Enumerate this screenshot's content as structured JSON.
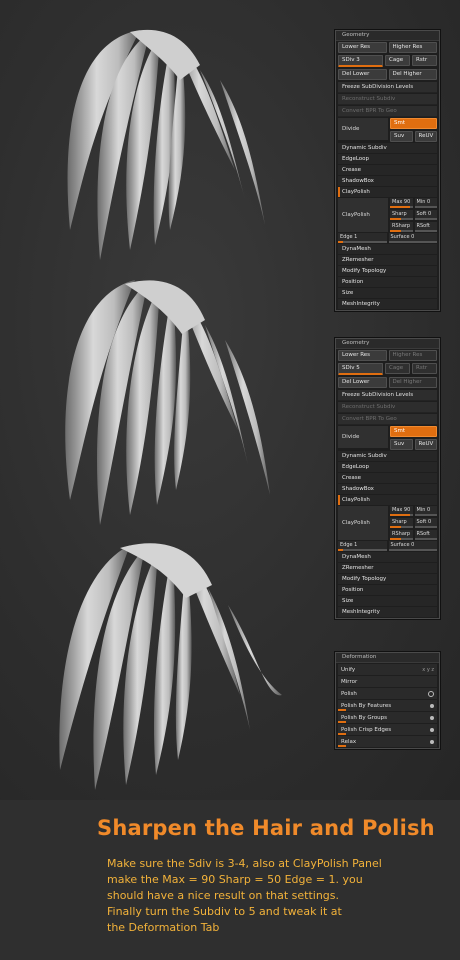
{
  "geometry_panel": {
    "title": "Geometry",
    "lower_res": "Lower Res",
    "higher_res": "Higher Res",
    "sdiv": "SDiv 3",
    "cage": "Cage",
    "rstr": "Rstr",
    "del_lower": "Del Lower",
    "del_higher": "Del Higher",
    "freeze": "Freeze SubDivision Levels",
    "reconstruct": "Reconstruct Subdiv",
    "convert": "Convert BPR To Geo",
    "divide": "Divide",
    "smt": "Smt",
    "suv": "Suv",
    "reuv": "ReUV",
    "dynamic_subdiv": "Dynamic Subdiv",
    "edgeloop": "EdgeLoop",
    "crease": "Crease",
    "shadowbox": "ShadowBox",
    "claypolish_header": "ClayPolish",
    "claypolish_button": "ClayPolish",
    "max": "Max 90",
    "min": "Min 0",
    "sharp": "Sharp",
    "soft": "Soft 0",
    "rsharp": "RSharp",
    "rsoft": "RSoft",
    "edge": "Edge 1",
    "surface": "Surface 0",
    "dynamesh": "DynaMesh",
    "zremesher": "ZRemesher",
    "modify_topology": "Modify Topology",
    "position": "Position",
    "size": "Size",
    "mesh_integrity": "MeshIntegrity"
  },
  "geometry_panel_2": {
    "title": "Geometry",
    "lower_res": "Lower Res",
    "higher_res": "Higher Res",
    "sdiv": "SDiv 5",
    "cage": "Cage",
    "rstr": "Rstr",
    "del_lower": "Del Lower",
    "del_higher": "Del Higher",
    "freeze": "Freeze SubDivision Levels",
    "reconstruct": "Reconstruct Subdiv",
    "convert": "Convert BPR To Geo",
    "divide": "Divide",
    "smt": "Smt",
    "suv": "Suv",
    "reuv": "ReUV",
    "dynamic_subdiv": "Dynamic Subdiv",
    "edgeloop": "EdgeLoop",
    "crease": "Crease",
    "shadowbox": "ShadowBox",
    "claypolish_header": "ClayPolish",
    "claypolish_button": "ClayPolish",
    "max": "Max 90",
    "min": "Min 0",
    "sharp": "Sharp",
    "soft": "Soft 0",
    "rsharp": "RSharp",
    "rsoft": "RSoft",
    "edge": "Edge 1",
    "surface": "Surface 0",
    "dynamesh": "DynaMesh",
    "zremesher": "ZRemesher",
    "modify_topology": "Modify Topology",
    "position": "Position",
    "size": "Size",
    "mesh_integrity": "MeshIntegrity"
  },
  "deformation_panel": {
    "title": "Deformation",
    "unify": "Unify",
    "unify_axes": "x y z",
    "mirror": "Mirror",
    "polish": "Polish",
    "polish_by_features": "Polish By Features",
    "polish_by_groups": "Polish By Groups",
    "polish_crisp_edges": "Polish Crisp Edges",
    "relax": "Relax"
  },
  "slider_levels": {
    "max": 0.9,
    "min": 0.0,
    "sharp": 0.5,
    "soft": 0.0,
    "rsharp": 0.5,
    "rsoft": 0.0,
    "edge": 0.1,
    "surface": 0.0
  },
  "caption": {
    "title": "Sharpen the Hair and Polish",
    "lines": [
      "Make sure the Sdiv is 3-4, also at ClayPolish Panel",
      "make the Max = 90 Sharp = 50 Edge = 1. you",
      "should have a nice result on that settings.",
      "Finally turn the Subdiv to 5 and tweak it at",
      "the Deformation Tab"
    ]
  },
  "colors": {
    "accent": "#e06e10",
    "caption_title": "#f08a2a",
    "caption_text": "#f2b23a",
    "background": "#2b2b2b"
  }
}
